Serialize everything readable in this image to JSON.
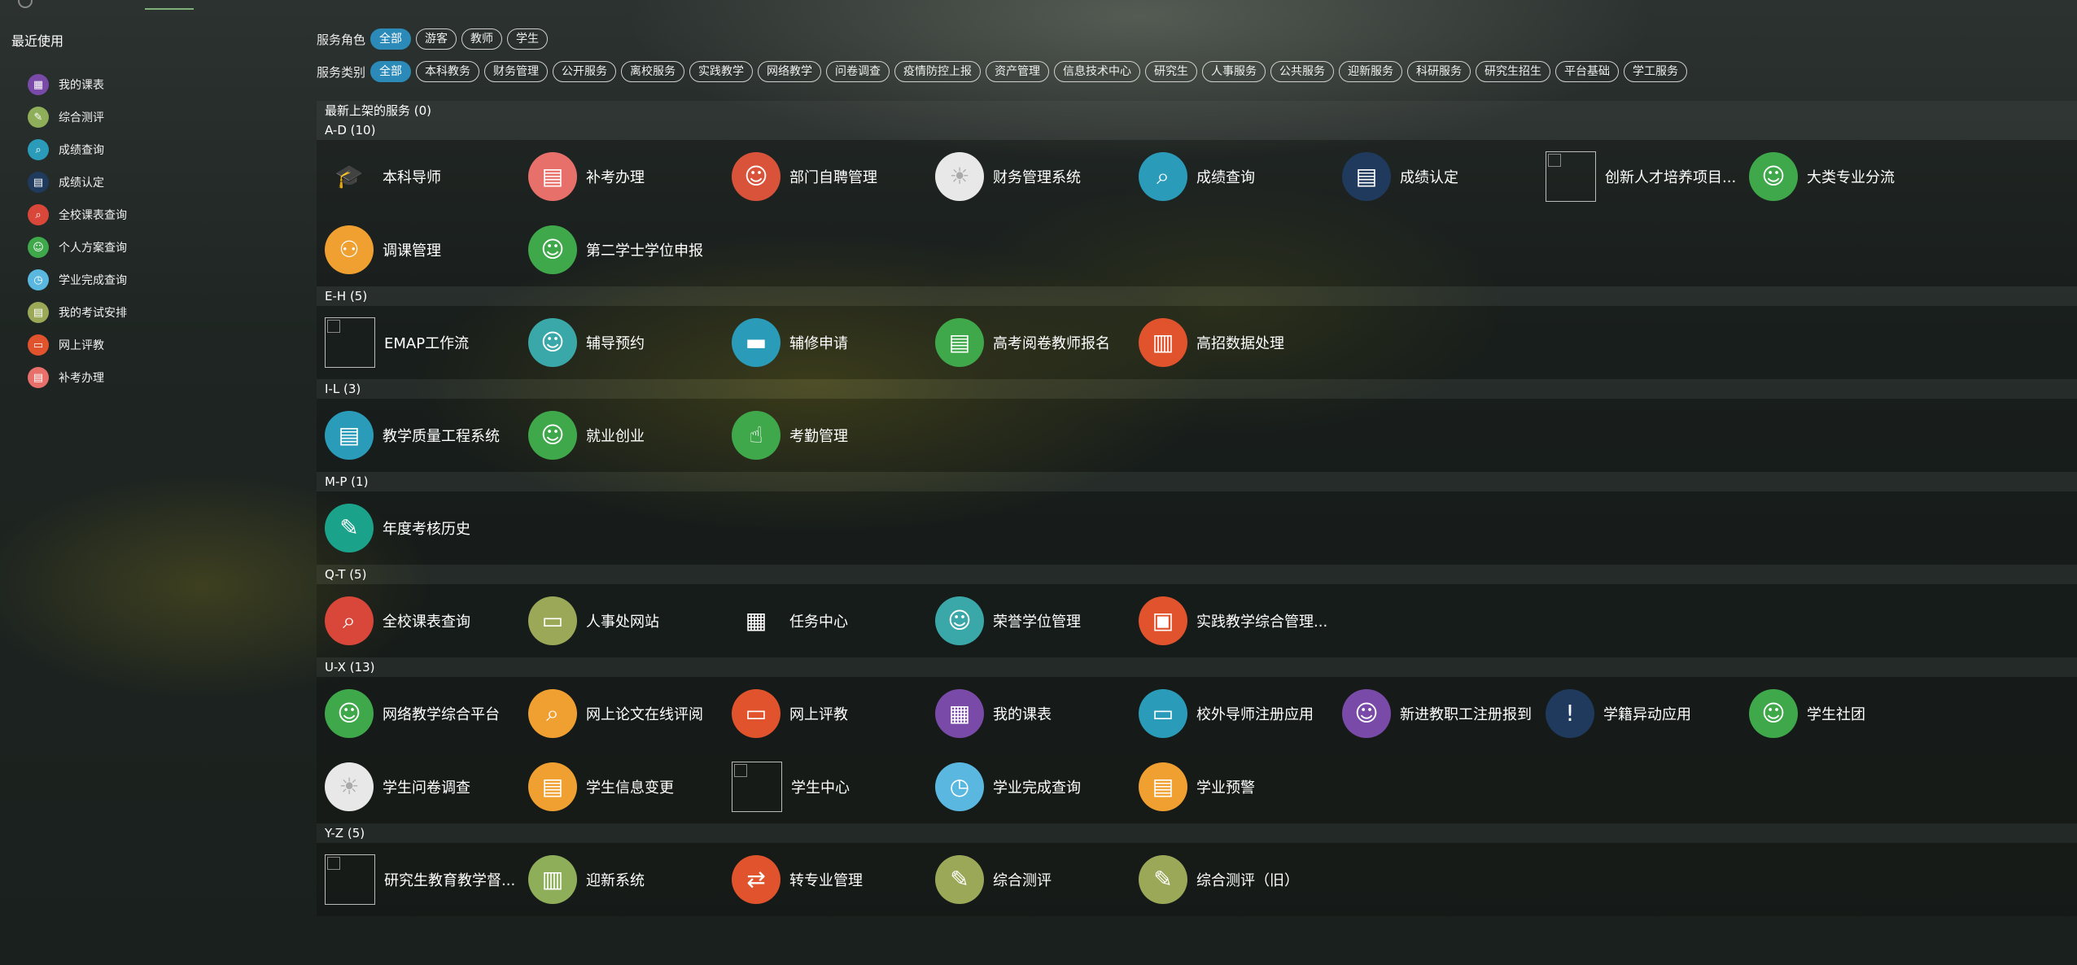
{
  "sidebar": {
    "title": "最近使用",
    "items": [
      {
        "label": "我的课表",
        "icon": "calendar-icon",
        "color": "#7a4aa8",
        "glyph": "▦"
      },
      {
        "label": "综合测评",
        "icon": "checklist-icon",
        "color": "#8fae5a",
        "glyph": "✎"
      },
      {
        "label": "成绩查询",
        "icon": "magnifier-icon",
        "color": "#2a9bb8",
        "glyph": "⌕"
      },
      {
        "label": "成绩认定",
        "icon": "book-icon",
        "color": "#1f3a5c",
        "glyph": "▤"
      },
      {
        "label": "全校课表查询",
        "icon": "calendar-search-icon",
        "color": "#d9473a",
        "glyph": "⌕"
      },
      {
        "label": "个人方案查询",
        "icon": "person-icon",
        "color": "#3fa84a",
        "glyph": "☺"
      },
      {
        "label": "学业完成查询",
        "icon": "alarm-clock-icon",
        "color": "#5ab8e0",
        "glyph": "◷"
      },
      {
        "label": "我的考试安排",
        "icon": "document-icon",
        "color": "#9aa858",
        "glyph": "▤"
      },
      {
        "label": "网上评教",
        "icon": "monitor-icon",
        "color": "#e0532c",
        "glyph": "▭"
      },
      {
        "label": "补考办理",
        "icon": "form-icon",
        "color": "#e8706a",
        "glyph": "▤"
      }
    ]
  },
  "filters": {
    "role_label": "服务角色",
    "roles": [
      {
        "label": "全部",
        "active": true
      },
      {
        "label": "游客",
        "active": false
      },
      {
        "label": "教师",
        "active": false
      },
      {
        "label": "学生",
        "active": false
      }
    ],
    "category_label": "服务类别",
    "categories": [
      {
        "label": "全部",
        "active": true
      },
      {
        "label": "本科教务",
        "active": false
      },
      {
        "label": "财务管理",
        "active": false
      },
      {
        "label": "公开服务",
        "active": false
      },
      {
        "label": "离校服务",
        "active": false
      },
      {
        "label": "实践教学",
        "active": false
      },
      {
        "label": "网络教学",
        "active": false
      },
      {
        "label": "问卷调查",
        "active": false
      },
      {
        "label": "疫情防控上报",
        "active": false
      },
      {
        "label": "资产管理",
        "active": false
      },
      {
        "label": "信息技术中心",
        "active": false
      },
      {
        "label": "研究生",
        "active": false
      },
      {
        "label": "人事服务",
        "active": false
      },
      {
        "label": "公共服务",
        "active": false
      },
      {
        "label": "迎新服务",
        "active": false
      },
      {
        "label": "科研服务",
        "active": false
      },
      {
        "label": "研究生招生",
        "active": false
      },
      {
        "label": "平台基础",
        "active": false
      },
      {
        "label": "学工服务",
        "active": false
      }
    ]
  },
  "sections": [
    {
      "title": "最新上架的服务 (0)",
      "items": []
    },
    {
      "title": "A-D (10)",
      "items": [
        {
          "name": "本科导师",
          "icon": "graduate-teacher-icon",
          "color": "transparent",
          "glyph": "🎓"
        },
        {
          "name": "补考办理",
          "icon": "form-icon",
          "color": "#e8706a",
          "glyph": "▤"
        },
        {
          "name": "部门自聘管理",
          "icon": "people-desk-icon",
          "color": "#d9533a",
          "glyph": "☺"
        },
        {
          "name": "财务管理系统",
          "icon": "landscape-image-icon",
          "color": "#e8e8e8",
          "glyph": "☀"
        },
        {
          "name": "成绩查询",
          "icon": "magnifier-icon",
          "color": "#2a9bb8",
          "glyph": "⌕"
        },
        {
          "name": "成绩认定",
          "icon": "book-icon",
          "color": "#1f3a5c",
          "glyph": "▤"
        },
        {
          "name": "创新人才培养项目...",
          "icon": "broken-image-icon",
          "color": "",
          "glyph": ""
        },
        {
          "name": "大类专业分流",
          "icon": "graduate-icon",
          "color": "#3fa84a",
          "glyph": "☺"
        },
        {
          "name": "调课管理",
          "icon": "people-network-icon",
          "color": "#f0a030",
          "glyph": "⚇"
        },
        {
          "name": "第二学士学位申报",
          "icon": "graduate-icon",
          "color": "#3fa84a",
          "glyph": "☺"
        }
      ]
    },
    {
      "title": "E-H (5)",
      "items": [
        {
          "name": "EMAP工作流",
          "icon": "broken-image-icon",
          "color": "",
          "glyph": ""
        },
        {
          "name": "辅导预约",
          "icon": "teacher-icon",
          "color": "#3aa8a8",
          "glyph": "☺"
        },
        {
          "name": "辅修申请",
          "icon": "desk-icon",
          "color": "#2a9bb8",
          "glyph": "▬"
        },
        {
          "name": "高考阅卷教师报名",
          "icon": "registration-icon",
          "color": "#3fa84a",
          "glyph": "▤"
        },
        {
          "name": "高招数据处理",
          "icon": "building-icon",
          "color": "#e0532c",
          "glyph": "▥"
        }
      ]
    },
    {
      "title": "I-L (3)",
      "items": [
        {
          "name": "教学质量工程系统",
          "icon": "document-chart-icon",
          "color": "#2a9bb8",
          "glyph": "▤"
        },
        {
          "name": "就业创业",
          "icon": "team-icon",
          "color": "#3fa84a",
          "glyph": "☺"
        },
        {
          "name": "考勤管理",
          "icon": "fingerprint-icon",
          "color": "#3fa84a",
          "glyph": "☝"
        }
      ]
    },
    {
      "title": "M-P (1)",
      "items": [
        {
          "name": "年度考核历史",
          "icon": "notepad-icon",
          "color": "#1aa38a",
          "glyph": "✎"
        }
      ]
    },
    {
      "title": "Q-T (5)",
      "items": [
        {
          "name": "全校课表查询",
          "icon": "calendar-search-icon",
          "color": "#d9473a",
          "glyph": "⌕"
        },
        {
          "name": "人事处网站",
          "icon": "blackboard-icon",
          "color": "#9aa858",
          "glyph": "▭"
        },
        {
          "name": "任务中心",
          "icon": "grid-task-icon",
          "color": "transparent",
          "glyph": "▦"
        },
        {
          "name": "荣誉学位管理",
          "icon": "student-icon",
          "color": "#3aa8a8",
          "glyph": "☺"
        },
        {
          "name": "实践教学综合管理...",
          "icon": "id-card-icon",
          "color": "#e0532c",
          "glyph": "▣"
        }
      ]
    },
    {
      "title": "U-X (13)",
      "items": [
        {
          "name": "网络教学综合平台",
          "icon": "graduate-icon",
          "color": "#3fa84a",
          "glyph": "☺"
        },
        {
          "name": "网上论文在线评阅",
          "icon": "paper-review-icon",
          "color": "#f0a030",
          "glyph": "⌕"
        },
        {
          "name": "网上评教",
          "icon": "monitor-icon",
          "color": "#e0532c",
          "glyph": "▭"
        },
        {
          "name": "我的课表",
          "icon": "calendar-icon",
          "color": "#7a4aa8",
          "glyph": "▦"
        },
        {
          "name": "校外导师注册应用",
          "icon": "presenter-icon",
          "color": "#2a9bb8",
          "glyph": "▭"
        },
        {
          "name": "新进教职工注册报到",
          "icon": "woman-check-icon",
          "color": "#7a4aa8",
          "glyph": "☺"
        },
        {
          "name": "学籍异动应用",
          "icon": "alert-document-icon",
          "color": "#1f3a5c",
          "glyph": "!"
        },
        {
          "name": "学生社团",
          "icon": "group-icon",
          "color": "#3fa84a",
          "glyph": "☺"
        },
        {
          "name": "学生问卷调查",
          "icon": "landscape-image-icon",
          "color": "#e8e8e8",
          "glyph": "☀"
        },
        {
          "name": "学生信息变更",
          "icon": "profile-card-icon",
          "color": "#f0a030",
          "glyph": "▤"
        },
        {
          "name": "学生中心",
          "icon": "broken-image-icon",
          "color": "",
          "glyph": ""
        },
        {
          "name": "学业完成查询",
          "icon": "alarm-clock-icon",
          "color": "#5ab8e0",
          "glyph": "◷"
        },
        {
          "name": "学业预警",
          "icon": "warning-book-icon",
          "color": "#f0a030",
          "glyph": "▤"
        }
      ]
    },
    {
      "title": "Y-Z (5)",
      "items": [
        {
          "name": "研究生教育教学督...",
          "icon": "broken-image-icon",
          "color": "",
          "glyph": ""
        },
        {
          "name": "迎新系统",
          "icon": "books-icon",
          "color": "#8fae5a",
          "glyph": "▥"
        },
        {
          "name": "转专业管理",
          "icon": "transfer-icon",
          "color": "#e0532c",
          "glyph": "⇄"
        },
        {
          "name": "综合测评",
          "icon": "checklist-search-icon",
          "color": "#9aa858",
          "glyph": "✎"
        },
        {
          "name": "综合测评（旧）",
          "icon": "checklist-icon",
          "color": "#9aa858",
          "glyph": "✎"
        }
      ]
    }
  ]
}
